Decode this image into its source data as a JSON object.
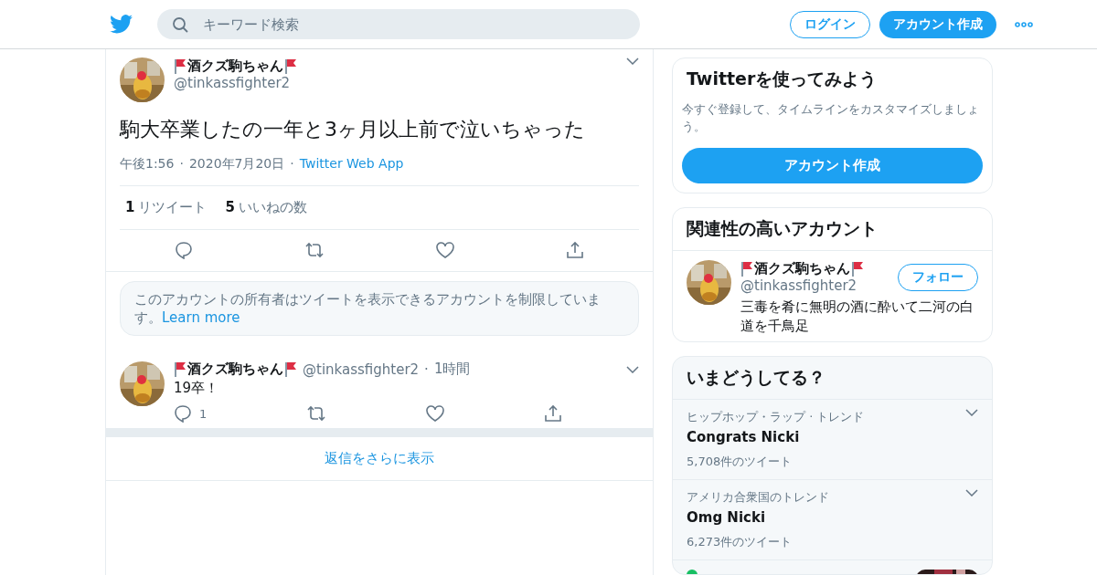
{
  "header": {
    "search_placeholder": "キーワード検索",
    "login": "ログイン",
    "signup": "アカウント作成"
  },
  "tweet": {
    "name": "酒クズ駒ちゃん",
    "flags": true,
    "handle": "@tinkassfighter2",
    "text": "駒大卒業したの一年と3ヶ月以上前で泣いちゃった",
    "separator": "·",
    "time": "午後1:56",
    "date": "2020年7月20日",
    "source": "Twitter Web App",
    "retweets": {
      "count": "1",
      "label": "リツイート"
    },
    "likes": {
      "count": "5",
      "label": "いいねの数"
    }
  },
  "notice": {
    "text": "このアカウントの所有者はツイートを表示できるアカウントを制限しています。",
    "link": "Learn more"
  },
  "reply": {
    "name": "酒クズ駒ちゃん",
    "flags": true,
    "handle": "@tinkassfighter2",
    "separator": "·",
    "time": "1時間",
    "text": "19卒！",
    "reply_count": "1"
  },
  "show_more": "返信をさらに表示",
  "signup_card": {
    "title": "Twitterを使ってみよう",
    "text": "今すぐ登録して、タイムラインをカスタマイズしましょう。",
    "button": "アカウント作成"
  },
  "related": {
    "title": "関連性の高いアカウント",
    "name": "酒クズ駒ちゃん",
    "flags": true,
    "handle": "@tinkassfighter2",
    "follow": "フォロー",
    "bio": "三毒を肴に無明の酒に酔いて二河の白道を千鳥足"
  },
  "trends": {
    "title": "いまどうしてる？",
    "items": [
      {
        "context": "ヒップホップ・ラップ · トレンド",
        "name": "Congrats Nicki",
        "count": "5,708件のツイート"
      },
      {
        "context": "アメリカ合衆国のトレンド",
        "name": "Omg Nicki",
        "count": "6,273件のツイート"
      }
    ]
  }
}
